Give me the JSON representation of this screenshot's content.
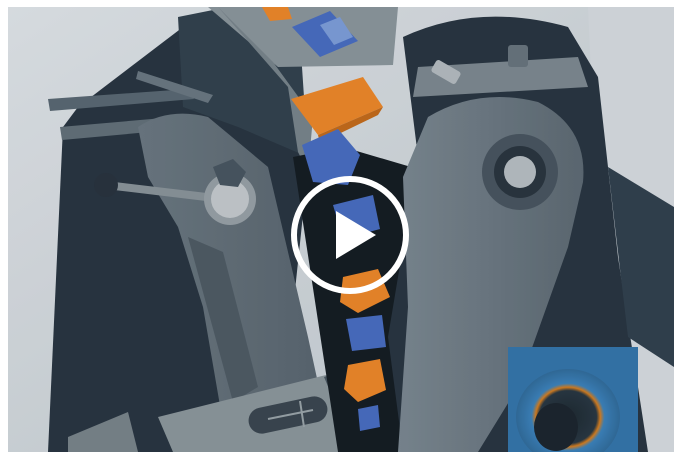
{
  "video": {
    "play_button_label": "",
    "state": "paused"
  },
  "colors": {
    "background_light": "#d5dbe0",
    "machine_dark": "#25323d",
    "machine_mid": "#3a4a57",
    "machine_plate": "#6f7c86",
    "block_orange": "#f08a2b",
    "block_blue": "#4a6fc4",
    "roller_blue": "#3b7fb8",
    "play_ring": "#ffffff"
  },
  "icons": {
    "play": "play-icon"
  }
}
